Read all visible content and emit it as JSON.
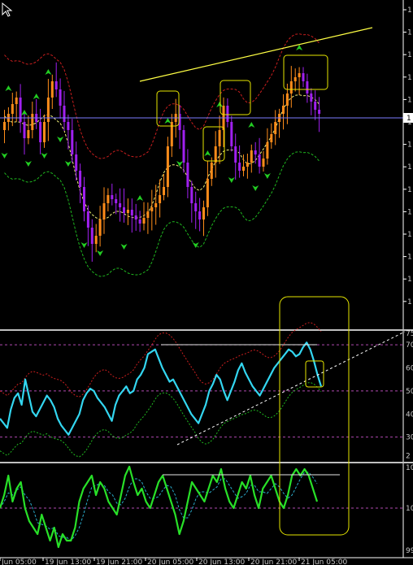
{
  "terminal": {
    "price_axis_labels": [
      "1",
      "1",
      "1",
      "1",
      "1",
      "1",
      "1",
      "1",
      "1",
      "1",
      "1",
      "1",
      "1",
      "1"
    ],
    "current_price_label": "1"
  },
  "chart_data": [
    {
      "type": "candlestick",
      "name": "main-price-chart",
      "colors": {
        "bull": "#ff8c1a",
        "bear": "#a020f0",
        "bollinger_upper": "#c81e1e",
        "bollinger_lower": "#1fb81f",
        "midline": "#f2f27a",
        "arrows": "#22cc22",
        "trendline": "#ffff44",
        "highlight_boxes": "#e6e600",
        "price_line": "#8080ff"
      },
      "indicators": [
        "Bollinger upper band",
        "Bollinger lower band",
        "Moving average",
        "Fractal arrows"
      ],
      "annotations": [
        "rising yellow trendline",
        "4 highlight boxes around swing highs"
      ]
    },
    {
      "type": "line",
      "name": "rsi-oscillator",
      "ylim": [
        20,
        75
      ],
      "y_ticks": [
        "75",
        "70",
        "60",
        "50",
        "40",
        "30",
        "2"
      ],
      "levels": [
        30,
        50,
        70
      ],
      "series": [
        {
          "color": "#33d6f0",
          "values": [
            38,
            36,
            34,
            42,
            47,
            49,
            44,
            55,
            48,
            41,
            39,
            42,
            45,
            48,
            46,
            43,
            38,
            35,
            33,
            31,
            34,
            37,
            40,
            46,
            49,
            51,
            50,
            47,
            45,
            43,
            40,
            37,
            44,
            48,
            50,
            52,
            49,
            50,
            55,
            57,
            60,
            66,
            67,
            68,
            64,
            60,
            57,
            54,
            55,
            52,
            49,
            46,
            43,
            40,
            38,
            36,
            40,
            44,
            50,
            53,
            57,
            55,
            50,
            46,
            50,
            54,
            59,
            62,
            58,
            55,
            52,
            50,
            48,
            51,
            54,
            57,
            60,
            62,
            64,
            66,
            68,
            67,
            65,
            66,
            69,
            71,
            68,
            63,
            57,
            52
          ]
        }
      ],
      "annotations": [
        "horizontal line near 75",
        "dashed rising trendline",
        "highlight box",
        "tall vertical box spanning both subpanels"
      ]
    },
    {
      "type": "line",
      "name": "momentum-oscillator",
      "y_ticks": [
        "10",
        "10",
        "99"
      ],
      "series": [
        {
          "color": "#28e028",
          "values": [
            100.0,
            100.2,
            100.5,
            100.1,
            100.3,
            100.4,
            100.0,
            99.8,
            99.7,
            99.6,
            99.9,
            99.7,
            99.5,
            99.7,
            99.4,
            99.6,
            99.5,
            99.5,
            99.7,
            100.1,
            100.3,
            100.4,
            100.5,
            100.2,
            100.4,
            100.3,
            100.1,
            100.0,
            99.9,
            100.2,
            100.5,
            100.7,
            100.4,
            100.2,
            100.3,
            100.1,
            100.0,
            100.2,
            100.4,
            100.5,
            100.3,
            100.1,
            99.9,
            99.6,
            99.8,
            100.1,
            100.4,
            100.3,
            100.2,
            100.1,
            100.3,
            100.5,
            100.4,
            100.6,
            100.3,
            100.1,
            100.0,
            100.2,
            100.4,
            100.3,
            100.5,
            100.2,
            100.0,
            100.3,
            100.4,
            100.5,
            100.3,
            100.1,
            100.0,
            100.2,
            100.5,
            100.6,
            100.5,
            100.6,
            100.5,
            100.3,
            100.1
          ]
        }
      ],
      "levels": [
        100
      ]
    }
  ],
  "time_axis": {
    "labels": [
      "Jun 05:00",
      "19 Jun 13:00",
      "19 Jun 21:00",
      "20 Jun 05:00",
      "20 Jun 13:00",
      "20 Jun 21:00",
      "21 Jun 05:00"
    ]
  }
}
